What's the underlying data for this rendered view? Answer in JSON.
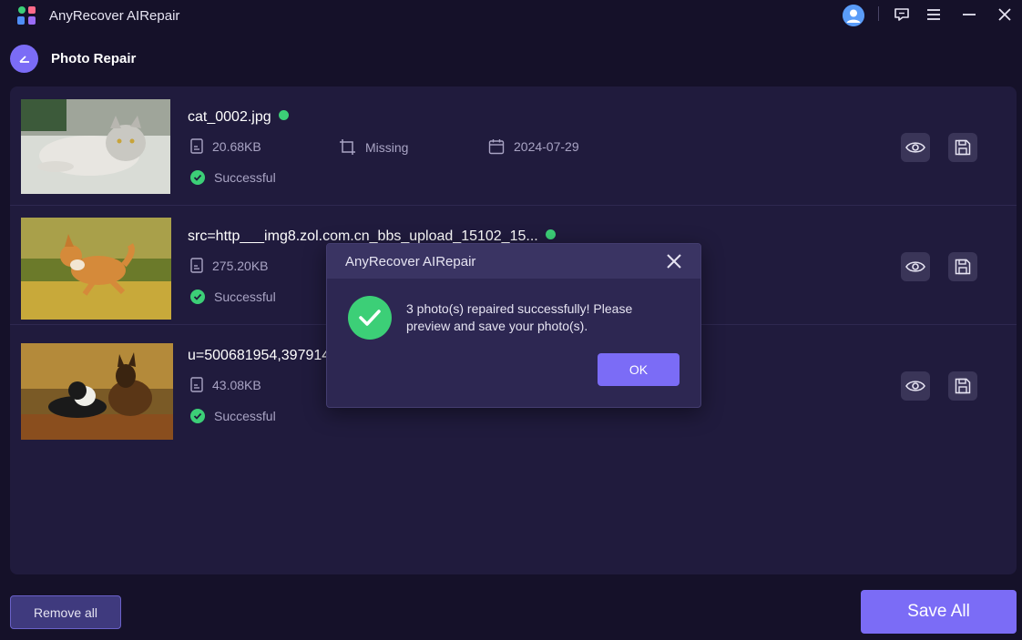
{
  "app": {
    "title": "AnyRecover AIRepair"
  },
  "header": {
    "page_title": "Photo Repair"
  },
  "photos": [
    {
      "filename": "cat_0002.jpg",
      "size": "20.68KB",
      "resolution": "Missing",
      "date": "2024-07-29",
      "status": "Successful"
    },
    {
      "filename": "src=http___img8.zol.com.cn_bbs_upload_15102_15...",
      "size": "275.20KB",
      "status": "Successful"
    },
    {
      "filename": "u=500681954,397914",
      "size": "43.08KB",
      "status": "Successful"
    }
  ],
  "footer": {
    "remove_all_label": "Remove all",
    "save_all_label": "Save All"
  },
  "dialog": {
    "title": "AnyRecover AIRepair",
    "message": "3 photo(s) repaired successfully! Please preview and save your photo(s).",
    "ok_label": "OK"
  },
  "colors": {
    "accent": "#7b6cf6",
    "success": "#3ccf77",
    "background": "#151129",
    "panel": "#201b3d"
  },
  "icons": [
    "app-logo-icon",
    "user-avatar-icon",
    "feedback-icon",
    "menu-icon",
    "minimize-icon",
    "close-icon",
    "back-icon",
    "file-size-icon",
    "resolution-icon",
    "calendar-icon",
    "check-icon",
    "eye-icon",
    "save-icon"
  ]
}
